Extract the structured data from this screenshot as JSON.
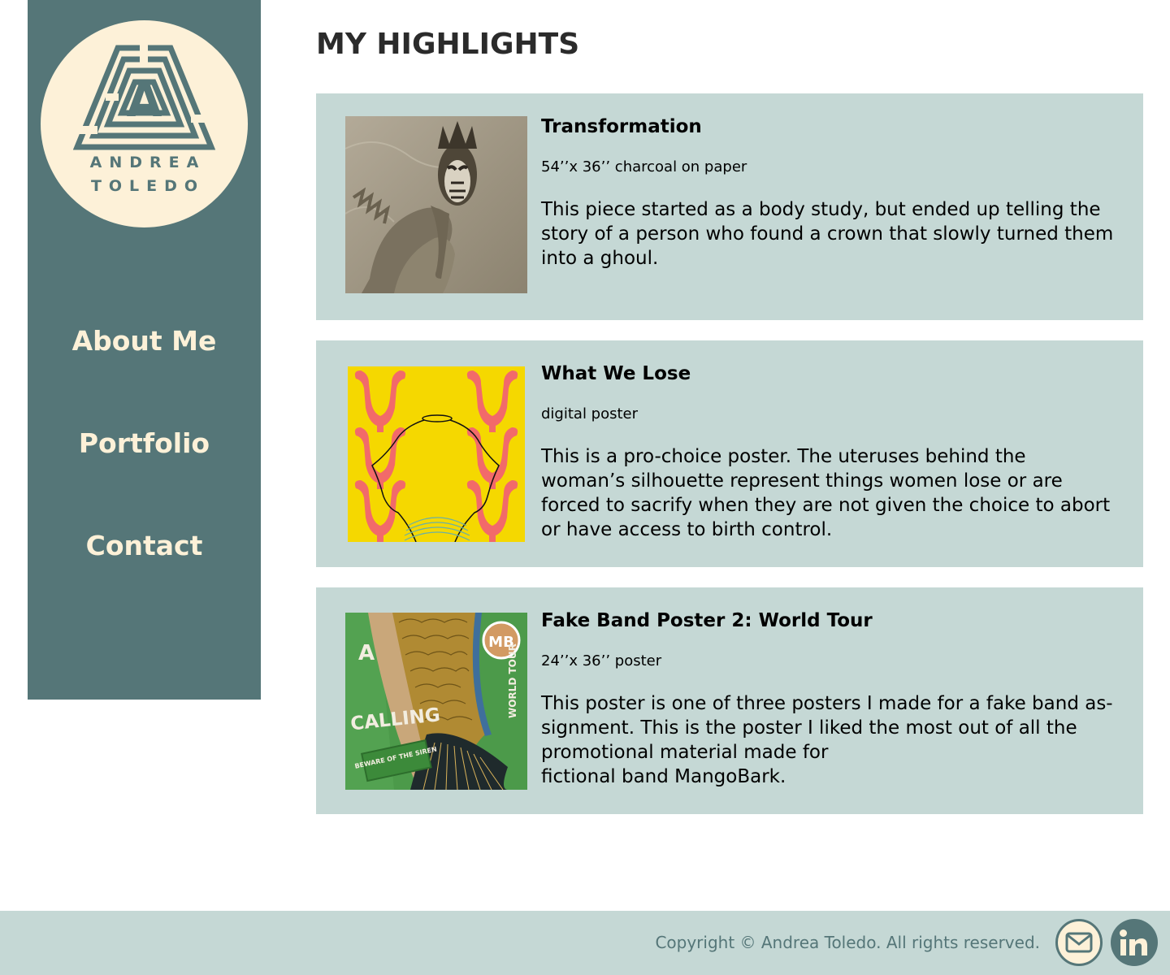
{
  "brand": {
    "first_name": "ANDREA",
    "last_name": "TOLEDO"
  },
  "nav": {
    "items": [
      {
        "label": "About Me"
      },
      {
        "label": "Portfolio"
      },
      {
        "label": "Contact"
      }
    ]
  },
  "main": {
    "title": "MY HIGHLIGHTS",
    "highlights": [
      {
        "title": "Transformation",
        "medium": "54’’x 36’’ charcoal on paper",
        "description": "This piece started as a body study, but ended up telling the story of a person who found a crown that slowly turned them into a ghoul."
      },
      {
        "title": "What We Lose",
        "medium": "digital poster",
        "description": "This is a pro-choice poster. The uteruses behind the\nwoman’s silhouette represent things women lose or are forced to sacrify when they are not given the choice to abort or have access to birth control."
      },
      {
        "title": "Fake Band Poster 2: World Tour",
        "medium": "24’’x 36’’ poster",
        "description": "This poster is one of three posters I made for  a fake band as-signment. This is the poster I liked the most out of all the promotional material made for\nfictional band MangoBark.",
        "poster_text": {
          "top": "A",
          "main": "CALLING",
          "badge": "MB",
          "tour": "WORLD TOUR",
          "sign": "BEWARE OF THE SIREN"
        }
      }
    ]
  },
  "footer": {
    "copyright": "Copyright © Andrea Toledo. All rights reserved."
  },
  "colors": {
    "sidebar": "#557678",
    "cream": "#fdf1d8",
    "card": "#c5d8d5",
    "poster_yellow": "#f5d800",
    "poster_pink": "#f26a6a",
    "poster_green": "#4c9a4a"
  },
  "icons": [
    "maze-a-logo",
    "mail-icon",
    "linkedin-icon"
  ]
}
